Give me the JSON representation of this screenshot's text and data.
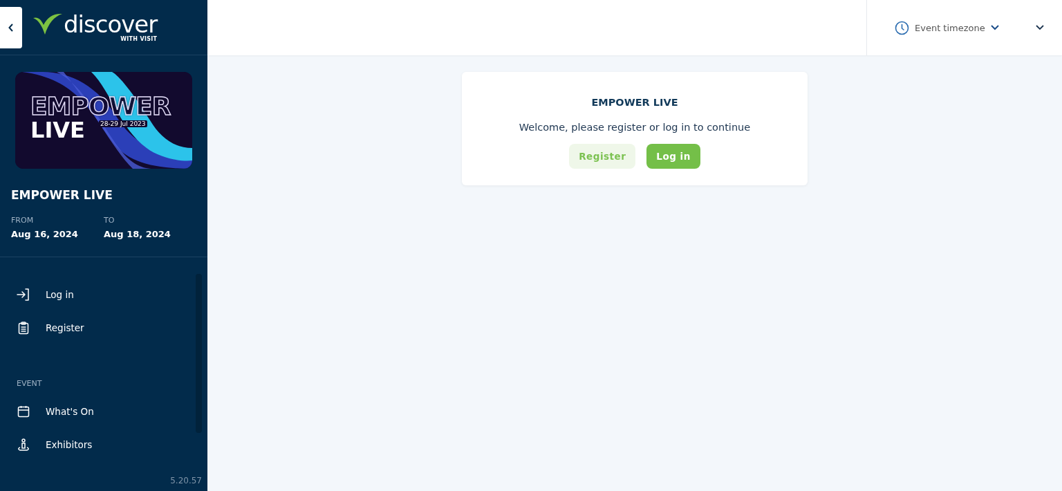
{
  "logo": {
    "wordmark": "discover",
    "tagline": "WITH VISIT"
  },
  "banner": {
    "outline_title": "EMPOWER",
    "title": "LIVE",
    "dates": "28-29 Jul 2023"
  },
  "event": {
    "title": "EMPOWER LIVE",
    "from_label": "FROM",
    "from": "Aug 16, 2024",
    "to_label": "TO",
    "to": "Aug 18, 2024"
  },
  "nav": [
    {
      "kind": "login",
      "label": "Log in"
    },
    {
      "kind": "register",
      "label": "Register"
    }
  ],
  "nav_sections": [
    {
      "heading": "EVENT",
      "items": [
        {
          "kind": "calendar",
          "label": "What's On"
        },
        {
          "kind": "exhibitors",
          "label": "Exhibitors"
        }
      ]
    }
  ],
  "version": "5.20.57",
  "topbar": {
    "timezone": "Event timezone"
  },
  "card": {
    "title": "EMPOWER LIVE",
    "message": "Welcome, please register or log in to continue",
    "buttons": [
      {
        "kind": "secondary",
        "label": "Register"
      },
      {
        "kind": "primary",
        "label": "Log in"
      }
    ]
  }
}
